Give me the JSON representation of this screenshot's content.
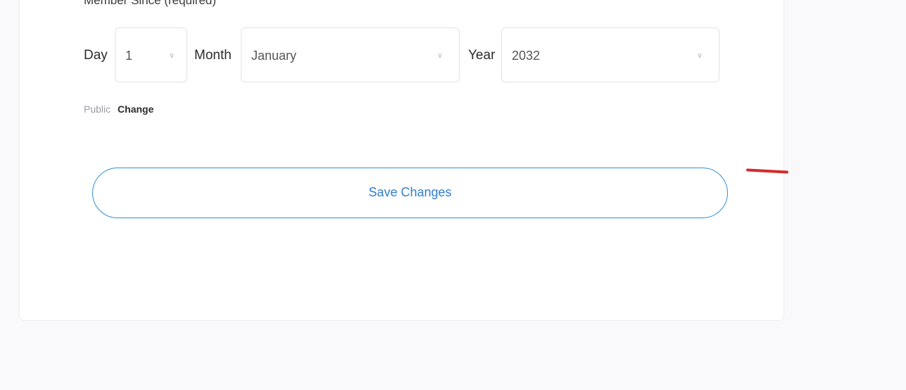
{
  "section": {
    "label": "Member Since (required)"
  },
  "date_fields": {
    "day": {
      "label": "Day",
      "value": "1"
    },
    "month": {
      "label": "Month",
      "value": "January"
    },
    "year": {
      "label": "Year",
      "value": "2032"
    }
  },
  "privacy": {
    "status": "Public",
    "change_label": "Change"
  },
  "actions": {
    "save_label": "Save Changes"
  },
  "colors": {
    "accent": "#2f8fd8",
    "annotation": "#d32a2a",
    "background": "#f9f9fc"
  },
  "icons": {
    "dropdown": "chevron-down-icon"
  }
}
